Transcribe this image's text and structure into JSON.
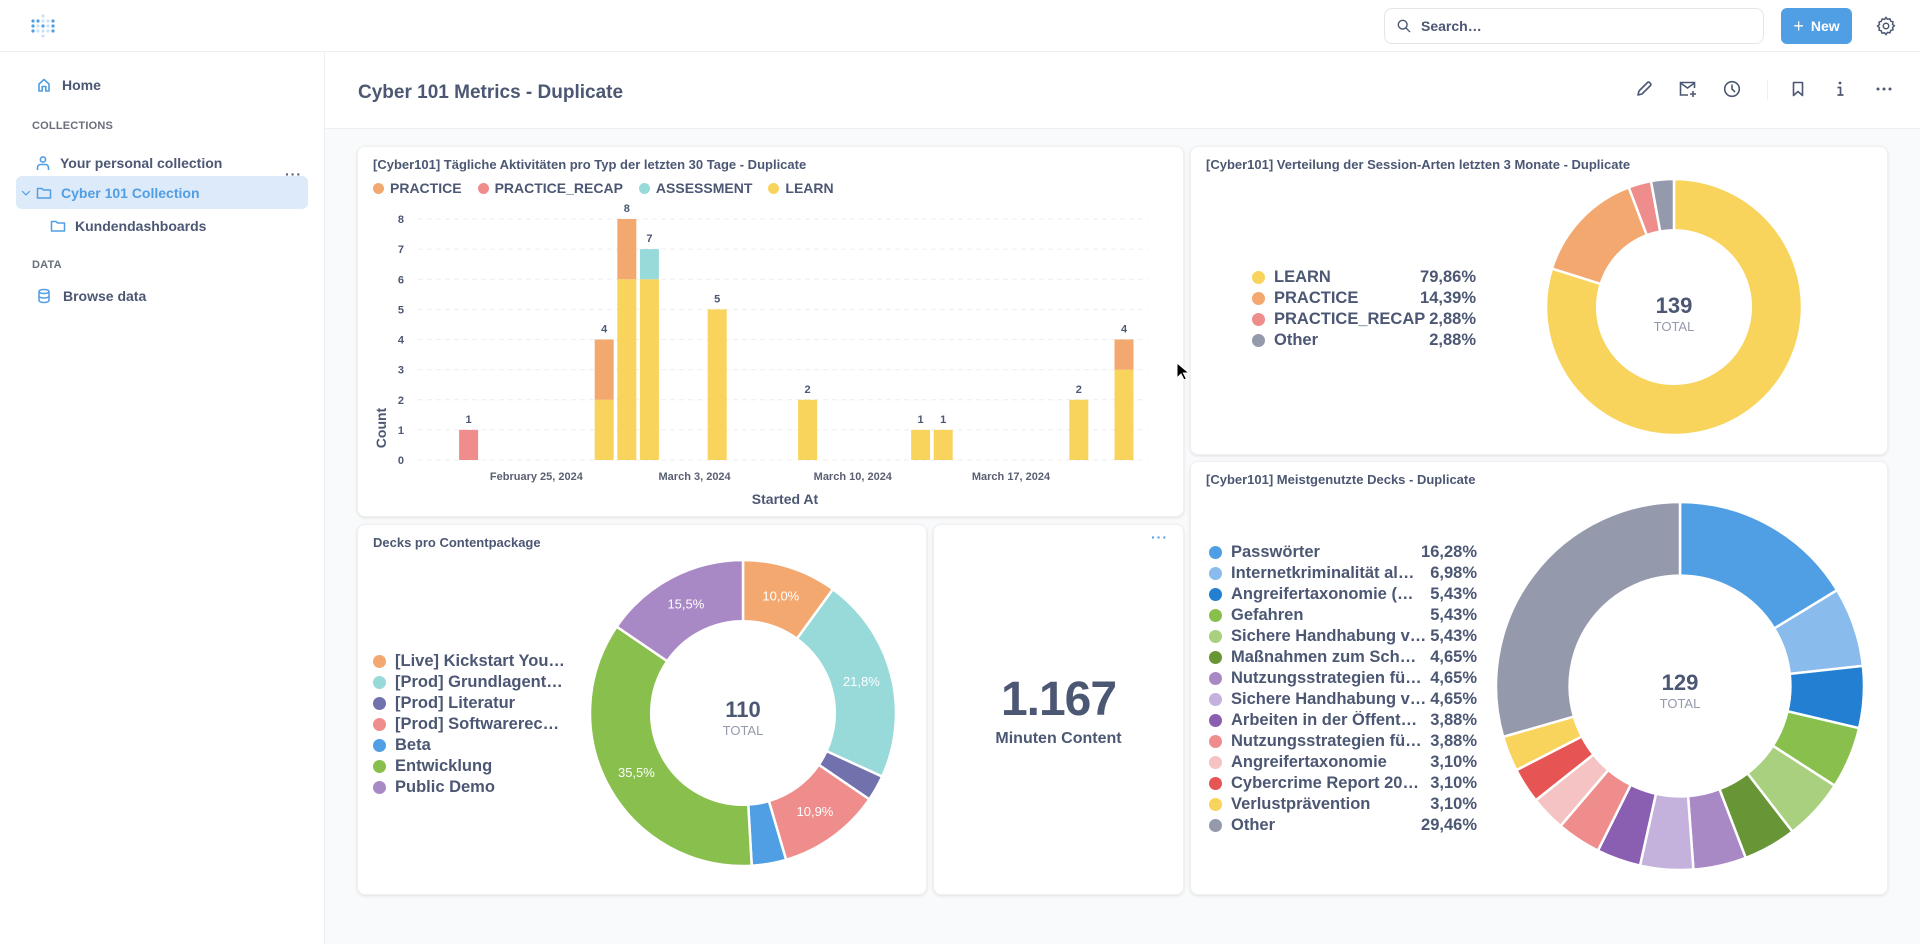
{
  "topbar": {
    "logo": "metabase-logo-icon",
    "search_placeholder": "Search…",
    "new_label": "New",
    "settings_icon": "gear-icon"
  },
  "sidebar": {
    "home_label": "Home",
    "collections_label": "COLLECTIONS",
    "collections_more": "···",
    "items": [
      {
        "label": "Your personal collection",
        "icon": "person-icon"
      },
      {
        "label": "Cyber 101 Collection",
        "icon": "folder-icon",
        "active": true,
        "expanded": true
      },
      {
        "label": "Kundendashboards",
        "icon": "folder-icon"
      }
    ],
    "data_label": "DATA",
    "browse_label": "Browse data"
  },
  "header": {
    "title": "Cyber 101 Metrics - Duplicate",
    "actions": [
      "pencil-icon",
      "subscription-icon",
      "clock-icon",
      "bookmark-icon",
      "info-icon",
      "more-icon"
    ]
  },
  "colors": {
    "PRACTICE": "#f2a86f",
    "PRACTICE_RECAP": "#ef8c8c",
    "ASSESSMENT": "#98d9d9",
    "LEARN": "#f9d45c",
    "Other": "#949aab",
    "brand": "#509ee3"
  },
  "cards": {
    "daily": {
      "title": "[Cyber101] Tägliche Aktivitäten pro Typ der letzten 30 Tage - Duplicate"
    },
    "sessions": {
      "title": "[Cyber101] Verteilung der Session-Arten letzten 3 Monate - Duplicate"
    },
    "packages": {
      "title": "Decks pro Contentpackage"
    },
    "scalar": {
      "value": "1.167",
      "label": "Minuten Content",
      "more": "···"
    },
    "decks": {
      "title": "[Cyber101] Meistgenutzte Decks - Duplicate"
    }
  },
  "chart_data": [
    {
      "type": "bar",
      "stacked": true,
      "title": "[Cyber101] Tägliche Aktivitäten pro Typ der letzten 30 Tage - Duplicate",
      "xlabel": "Started At",
      "ylabel": "Count",
      "ylim": [
        0,
        8
      ],
      "yticks": [
        "0",
        "1",
        "2",
        "3",
        "4",
        "5",
        "6",
        "7",
        "8"
      ],
      "xticks": [
        {
          "label": "February 25, 2024",
          "date": "2024-02-25"
        },
        {
          "label": "March 3, 2024",
          "date": "2024-03-03"
        },
        {
          "label": "March 10, 2024",
          "date": "2024-03-10"
        },
        {
          "label": "March 17, 2024",
          "date": "2024-03-17"
        }
      ],
      "x_range": [
        "2024-02-21",
        "2024-03-22"
      ],
      "grid": true,
      "legend_position": "top-left",
      "series_order": [
        "PRACTICE",
        "PRACTICE_RECAP",
        "ASSESSMENT",
        "LEARN"
      ],
      "bars": [
        {
          "date": "2024-02-22",
          "LEARN": 0,
          "PRACTICE": 0,
          "ASSESSMENT": 0,
          "PRACTICE_RECAP": 1,
          "total": 1
        },
        {
          "date": "2024-02-28",
          "LEARN": 2,
          "PRACTICE": 2,
          "ASSESSMENT": 0,
          "PRACTICE_RECAP": 0,
          "total": 4
        },
        {
          "date": "2024-02-29",
          "LEARN": 6,
          "PRACTICE": 2,
          "ASSESSMENT": 0,
          "PRACTICE_RECAP": 0,
          "total": 8
        },
        {
          "date": "2024-03-01",
          "LEARN": 6,
          "PRACTICE": 0,
          "ASSESSMENT": 1,
          "PRACTICE_RECAP": 0,
          "total": 7
        },
        {
          "date": "2024-03-04",
          "LEARN": 5,
          "PRACTICE": 0,
          "ASSESSMENT": 0,
          "PRACTICE_RECAP": 0,
          "total": 5
        },
        {
          "date": "2024-03-08",
          "LEARN": 2,
          "PRACTICE": 0,
          "ASSESSMENT": 0,
          "PRACTICE_RECAP": 0,
          "total": 2
        },
        {
          "date": "2024-03-13",
          "LEARN": 1,
          "PRACTICE": 0,
          "ASSESSMENT": 0,
          "PRACTICE_RECAP": 0,
          "total": 1
        },
        {
          "date": "2024-03-14",
          "LEARN": 1,
          "PRACTICE": 0,
          "ASSESSMENT": 0,
          "PRACTICE_RECAP": 0,
          "total": 1
        },
        {
          "date": "2024-03-20",
          "LEARN": 2,
          "PRACTICE": 0,
          "ASSESSMENT": 0,
          "PRACTICE_RECAP": 0,
          "total": 2
        },
        {
          "date": "2024-03-22",
          "LEARN": 3,
          "PRACTICE": 1,
          "ASSESSMENT": 0,
          "PRACTICE_RECAP": 0,
          "total": 4
        }
      ]
    },
    {
      "type": "pie",
      "donut": true,
      "title": "[Cyber101] Verteilung der Session-Arten letzten 3 Monate - Duplicate",
      "total": "139",
      "total_label": "TOTAL",
      "legend_position": "left",
      "slices": [
        {
          "label": "LEARN",
          "value": 111,
          "pct": "79,86%",
          "color": "#f9d45c"
        },
        {
          "label": "PRACTICE",
          "value": 20,
          "pct": "14,39%",
          "color": "#f2a86f"
        },
        {
          "label": "PRACTICE_RECAP",
          "value": 4,
          "pct": "2,88%",
          "color": "#ef8c8c"
        },
        {
          "label": "Other",
          "value": 4,
          "pct": "2,88%",
          "color": "#949aab"
        }
      ]
    },
    {
      "type": "pie",
      "donut": true,
      "title": "Decks pro Contentpackage",
      "total": "110",
      "total_label": "TOTAL",
      "legend_position": "left",
      "slices": [
        {
          "label": "[Live] Kickstart You…",
          "value": 11,
          "pct_label": "10,0%",
          "color": "#f2a86f"
        },
        {
          "label": "[Prod] Grundlagent…",
          "value": 24,
          "pct_label": "21,8%",
          "color": "#98d9d9"
        },
        {
          "label": "[Prod] Literatur",
          "value": 3,
          "pct_label": "",
          "color": "#7172ad"
        },
        {
          "label": "[Prod] Softwarerec…",
          "value": 12,
          "pct_label": "10,9%",
          "color": "#ef8c8c"
        },
        {
          "label": "Beta",
          "value": 4,
          "pct_label": "",
          "color": "#509ee3"
        },
        {
          "label": "Entwicklung",
          "value": 39,
          "pct_label": "35,5%",
          "color": "#88bf4d"
        },
        {
          "label": "Public Demo",
          "value": 17,
          "pct_label": "15,5%",
          "color": "#a989c5"
        }
      ]
    },
    {
      "type": "pie",
      "donut": true,
      "title": "[Cyber101] Meistgenutzte Decks - Duplicate",
      "total": "129",
      "total_label": "TOTAL",
      "legend_position": "left",
      "slices": [
        {
          "label": "Passwörter",
          "value": 21,
          "pct": "16,28%",
          "color": "#509ee3"
        },
        {
          "label": "Internetkriminalität al…",
          "value": 9,
          "pct": "6,98%",
          "color": "#8abbed"
        },
        {
          "label": "Angreifertaxonomie (…",
          "value": 7,
          "pct": "5,43%",
          "color": "#227fd2"
        },
        {
          "label": "Gefahren",
          "value": 7,
          "pct": "5,43%",
          "color": "#88bf4d"
        },
        {
          "label": "Sichere Handhabung v…",
          "value": 7,
          "pct": "5,43%",
          "color": "#a8d07f"
        },
        {
          "label": "Maßnahmen zum Sch…",
          "value": 6,
          "pct": "4,65%",
          "color": "#689636"
        },
        {
          "label": "Nutzungsstrategien fü…",
          "value": 6,
          "pct": "4,65%",
          "color": "#a989c5"
        },
        {
          "label": "Sichere Handhabung v…",
          "value": 6,
          "pct": "4,65%",
          "color": "#c5b2dc"
        },
        {
          "label": "Arbeiten in der Öffent…",
          "value": 5,
          "pct": "3,88%",
          "color": "#8a5eb0"
        },
        {
          "label": "Nutzungsstrategien fü…",
          "value": 5,
          "pct": "3,88%",
          "color": "#ef8c8c"
        },
        {
          "label": "Angreifertaxonomie",
          "value": 4,
          "pct": "3,10%",
          "color": "#f5c3c3"
        },
        {
          "label": "Cybercrime Report 20…",
          "value": 4,
          "pct": "3,10%",
          "color": "#e75454"
        },
        {
          "label": "Verlustprävention",
          "value": 4,
          "pct": "3,10%",
          "color": "#f9d45c"
        },
        {
          "label": "Other",
          "value": 38,
          "pct": "29,46%",
          "color": "#949aab"
        }
      ]
    }
  ]
}
